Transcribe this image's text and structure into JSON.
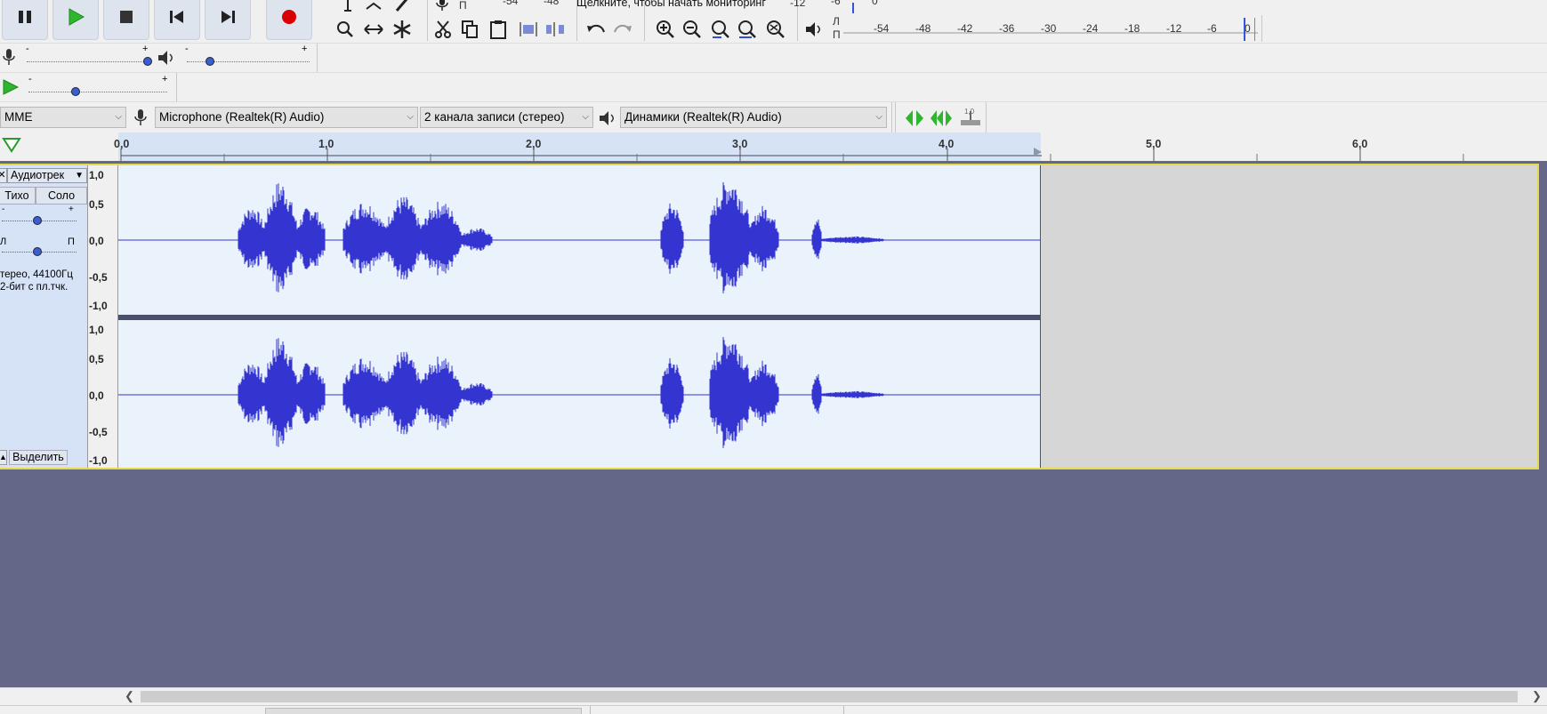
{
  "transport": {
    "pause": "pause-icon",
    "play": "play-icon",
    "stop": "stop-icon",
    "skip_start": "skip-start-icon",
    "skip_end": "skip-end-icon",
    "record": "record-icon",
    "record_color": "#d90000"
  },
  "meter": {
    "record_ticks": [
      "-54",
      "-48"
    ],
    "click_monitor": "Щелкните, чтобы начать мониторинг",
    "record_ticks2": [
      "-12",
      "-6",
      "0"
    ],
    "playback_ticks": [
      "-54",
      "-48",
      "-42",
      "-36",
      "-30",
      "-24",
      "-18",
      "-12",
      "-6",
      "0"
    ],
    "left": "Л",
    "right": "П"
  },
  "mixer": {
    "minus": "-",
    "plus": "+"
  },
  "device": {
    "host": "MME",
    "mic": "Microphone (Realtek(R) Audio)",
    "channels": "2 канала записи (стерео)",
    "speakers": "Динамики (Realtek(R) Audio)",
    "play_at_speed": "1,0"
  },
  "ruler": {
    "ticks": [
      "0,0",
      "1,0",
      "2,0",
      "3,0",
      "4,0",
      "5,0",
      "6,0"
    ]
  },
  "track": {
    "name": "Аудиотрек",
    "mute": "Тихо",
    "solo": "Соло",
    "pan_left": "Л",
    "pan_right": "П",
    "info1": "терео, 44100Гц",
    "info2": "2-бит с пл.тчк.",
    "select": "Выделить",
    "y_labels": [
      "1,0",
      "0,5",
      "0,0",
      "-0,5",
      "-1,0"
    ],
    "wave_color": "#3434d0",
    "bg_color": "#eaf2fc"
  }
}
